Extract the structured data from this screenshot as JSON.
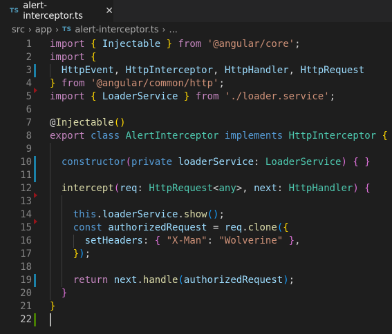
{
  "tab": {
    "badge": "TS",
    "title": "alert-interceptor.ts",
    "close": "✕"
  },
  "breadcrumb": {
    "parts": [
      "src",
      "app"
    ],
    "badge": "TS",
    "file": "alert-interceptor.ts",
    "more": "..."
  },
  "editor": {
    "lines": [
      {
        "n": "1",
        "tokens": [
          [
            "kc",
            "import"
          ],
          [
            "p",
            " "
          ],
          [
            "b1",
            "{"
          ],
          [
            "p",
            " "
          ],
          [
            "v",
            "Injectable"
          ],
          [
            "p",
            " "
          ],
          [
            "b1",
            "}"
          ],
          [
            "p",
            " "
          ],
          [
            "kc",
            "from"
          ],
          [
            "p",
            " "
          ],
          [
            "s",
            "'@angular/core'"
          ],
          [
            "p",
            ";"
          ]
        ]
      },
      {
        "n": "2",
        "tokens": [
          [
            "kc",
            "import"
          ],
          [
            "p",
            " "
          ],
          [
            "b1",
            "{"
          ]
        ]
      },
      {
        "n": "3",
        "tokens": [
          [
            "p",
            "  "
          ],
          [
            "v",
            "HttpEvent"
          ],
          [
            "p",
            ", "
          ],
          [
            "v",
            "HttpInterceptor"
          ],
          [
            "p",
            ", "
          ],
          [
            "v",
            "HttpHandler"
          ],
          [
            "p",
            ", "
          ],
          [
            "v",
            "HttpRequest"
          ]
        ]
      },
      {
        "n": "4",
        "tokens": [
          [
            "b1",
            "}"
          ],
          [
            "p",
            " "
          ],
          [
            "kc",
            "from"
          ],
          [
            "p",
            " "
          ],
          [
            "s",
            "'@angular/common/http'"
          ],
          [
            "p",
            ";"
          ]
        ]
      },
      {
        "n": "5",
        "tokens": [
          [
            "kc",
            "import"
          ],
          [
            "p",
            " "
          ],
          [
            "b1",
            "{"
          ],
          [
            "p",
            " "
          ],
          [
            "v",
            "LoaderService"
          ],
          [
            "p",
            " "
          ],
          [
            "b1",
            "}"
          ],
          [
            "p",
            " "
          ],
          [
            "kc",
            "from"
          ],
          [
            "p",
            " "
          ],
          [
            "s",
            "'./loader.service'"
          ],
          [
            "p",
            ";"
          ]
        ]
      },
      {
        "n": "6",
        "tokens": []
      },
      {
        "n": "7",
        "tokens": [
          [
            "p",
            "@"
          ],
          [
            "f",
            "Injectable"
          ],
          [
            "b1",
            "()"
          ]
        ]
      },
      {
        "n": "8",
        "tokens": [
          [
            "kc",
            "export"
          ],
          [
            "p",
            " "
          ],
          [
            "k",
            "class"
          ],
          [
            "p",
            " "
          ],
          [
            "t",
            "AlertInterceptor"
          ],
          [
            "p",
            " "
          ],
          [
            "k",
            "implements"
          ],
          [
            "p",
            " "
          ],
          [
            "t",
            "HttpInterceptor"
          ],
          [
            "p",
            " "
          ],
          [
            "b1",
            "{"
          ]
        ]
      },
      {
        "n": "9",
        "tokens": []
      },
      {
        "n": "10",
        "tokens": [
          [
            "p",
            "  "
          ],
          [
            "k",
            "constructor"
          ],
          [
            "b2",
            "("
          ],
          [
            "k",
            "private"
          ],
          [
            "p",
            " "
          ],
          [
            "v",
            "loaderService"
          ],
          [
            "p",
            ": "
          ],
          [
            "t",
            "LoaderService"
          ],
          [
            "b2",
            ")"
          ],
          [
            "p",
            " "
          ],
          [
            "b2",
            "{"
          ],
          [
            "p",
            " "
          ],
          [
            "b2",
            "}"
          ]
        ]
      },
      {
        "n": "11",
        "tokens": []
      },
      {
        "n": "12",
        "tokens": [
          [
            "p",
            "  "
          ],
          [
            "f",
            "intercept"
          ],
          [
            "b2",
            "("
          ],
          [
            "v",
            "req"
          ],
          [
            "p",
            ": "
          ],
          [
            "t",
            "HttpRequest"
          ],
          [
            "p",
            "<"
          ],
          [
            "t",
            "any"
          ],
          [
            "p",
            ">"
          ],
          [
            "p",
            ", "
          ],
          [
            "v",
            "next"
          ],
          [
            "p",
            ": "
          ],
          [
            "t",
            "HttpHandler"
          ],
          [
            "b2",
            ")"
          ],
          [
            "p",
            " "
          ],
          [
            "b2",
            "{"
          ]
        ]
      },
      {
        "n": "13",
        "tokens": []
      },
      {
        "n": "14",
        "tokens": [
          [
            "p",
            "    "
          ],
          [
            "k",
            "this"
          ],
          [
            "p",
            "."
          ],
          [
            "v",
            "loaderService"
          ],
          [
            "p",
            "."
          ],
          [
            "f",
            "show"
          ],
          [
            "b3",
            "()"
          ],
          [
            "p",
            ";"
          ]
        ]
      },
      {
        "n": "15",
        "tokens": [
          [
            "p",
            "    "
          ],
          [
            "k",
            "const"
          ],
          [
            "p",
            " "
          ],
          [
            "v",
            "authorizedRequest"
          ],
          [
            "p",
            " = "
          ],
          [
            "v",
            "req"
          ],
          [
            "p",
            "."
          ],
          [
            "f",
            "clone"
          ],
          [
            "b3",
            "("
          ],
          [
            "b1",
            "{"
          ]
        ]
      },
      {
        "n": "16",
        "tokens": [
          [
            "p",
            "      "
          ],
          [
            "v",
            "setHeaders"
          ],
          [
            "p",
            ": "
          ],
          [
            "b2",
            "{"
          ],
          [
            "p",
            " "
          ],
          [
            "s",
            "\"X-Man\""
          ],
          [
            "p",
            ": "
          ],
          [
            "s",
            "\"Wolverine\""
          ],
          [
            "p",
            " "
          ],
          [
            "b2",
            "}"
          ],
          [
            "p",
            ","
          ]
        ]
      },
      {
        "n": "17",
        "tokens": [
          [
            "p",
            "    "
          ],
          [
            "b1",
            "}"
          ],
          [
            "b3",
            ")"
          ],
          [
            "p",
            ";"
          ]
        ]
      },
      {
        "n": "18",
        "tokens": []
      },
      {
        "n": "19",
        "tokens": [
          [
            "p",
            "    "
          ],
          [
            "kc",
            "return"
          ],
          [
            "p",
            " "
          ],
          [
            "v",
            "next"
          ],
          [
            "p",
            "."
          ],
          [
            "f",
            "handle"
          ],
          [
            "b3",
            "("
          ],
          [
            "v",
            "authorizedRequest"
          ],
          [
            "b3",
            ")"
          ],
          [
            "p",
            ";"
          ]
        ]
      },
      {
        "n": "20",
        "tokens": [
          [
            "p",
            "  "
          ],
          [
            "b2",
            "}"
          ]
        ]
      },
      {
        "n": "21",
        "tokens": [
          [
            "b1",
            "}"
          ]
        ]
      },
      {
        "n": "22",
        "tokens": []
      }
    ]
  }
}
